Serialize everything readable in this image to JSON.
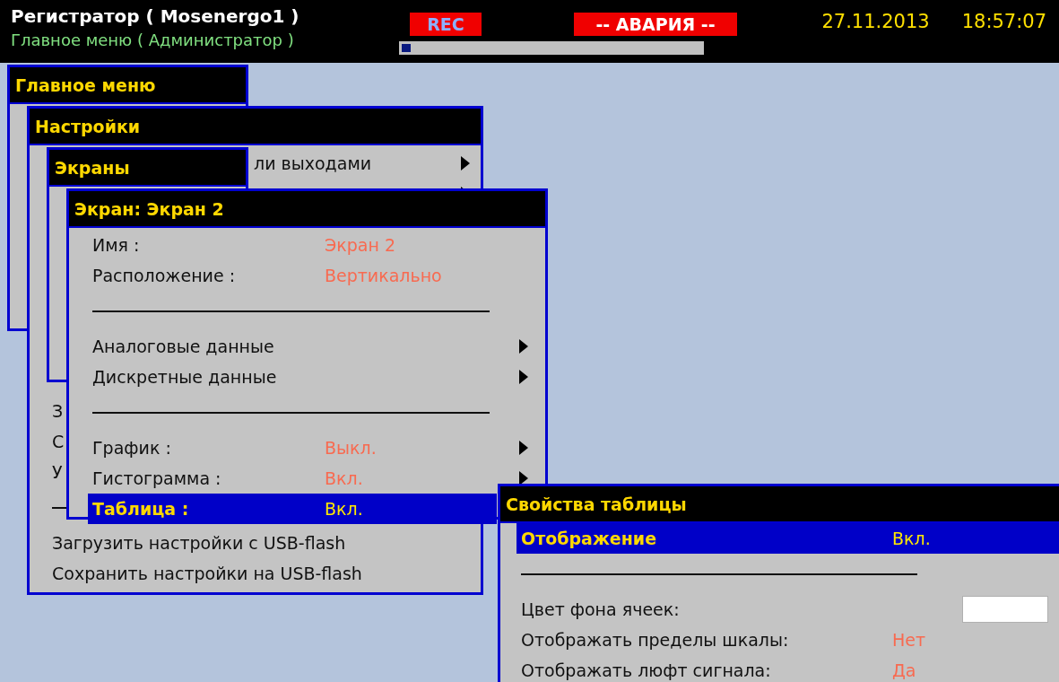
{
  "header": {
    "title": "Регистратор ( Mosenergo1 )",
    "subtitle": "Главное меню ( Администратор )",
    "rec": "REC",
    "alarm": "-- АВАРИЯ --",
    "date": "27.11.2013",
    "time": "18:57:07",
    "progress": {
      "level": 0.03
    }
  },
  "windows": [
    {
      "title": "Главное меню"
    },
    {
      "title": "Настройки",
      "sections": [
        {
          "items": [
            {
              "kind": "cut_off",
              "label": "ли выходами",
              "submenu": true,
              "selected": false
            },
            {
              "kind": "cut_off",
              "submenu": true,
              "selected": false
            }
          ]
        },
        {
          "items": [
            {
              "kind": "option",
              "label": "З",
              "selected": false
            },
            {
              "kind": "option",
              "label": "С",
              "selected": false
            },
            {
              "kind": "option",
              "label": "У",
              "selected": false
            },
            {
              "kind": "separator"
            },
            {
              "kind": "option",
              "label": "Загрузить настройки с USB-flash",
              "selected": false
            },
            {
              "kind": "option",
              "label": "Сохранить настройки на USB-flash",
              "selected": false
            }
          ]
        }
      ]
    },
    {
      "title": "Экраны"
    },
    {
      "title": "Экран: Экран 2",
      "sections": [
        {
          "items": [
            {
              "kind": "option",
              "label": "Имя :",
              "value": "Экран 2",
              "selected": false
            },
            {
              "kind": "option",
              "label": "Расположение :",
              "value": "Вертикально",
              "selected": false
            },
            {
              "kind": "separator"
            },
            {
              "kind": "option",
              "label": "Аналоговые данные",
              "submenu": true,
              "selected": false
            },
            {
              "kind": "option",
              "label": "Дискретные данные",
              "submenu": true,
              "selected": false
            },
            {
              "kind": "separator"
            },
            {
              "kind": "option",
              "label": "График :",
              "value": "Выкл.",
              "submenu": true,
              "selected": false
            },
            {
              "kind": "option",
              "label": "Гистограмма :",
              "value": "Вкл.",
              "submenu": true,
              "selected": false
            },
            {
              "kind": "option",
              "label": "Таблица :",
              "value": "Вкл.",
              "selected": true
            }
          ]
        }
      ]
    },
    {
      "title": "Свойства таблицы",
      "sections": [
        {
          "items": [
            {
              "kind": "option",
              "label": "Отображение",
              "value": "Вкл.",
              "selected": true
            },
            {
              "kind": "separator"
            },
            {
              "kind": "swatch",
              "label": "Цвет фона ячеек:",
              "color": "#ffffff",
              "selected": false
            },
            {
              "kind": "option",
              "label": "Отображать пределы шкалы:",
              "value": "Нет",
              "selected": false
            },
            {
              "kind": "option",
              "label": "Отображать люфт сигнала:",
              "value": "Да",
              "selected": false
            }
          ]
        }
      ]
    }
  ]
}
